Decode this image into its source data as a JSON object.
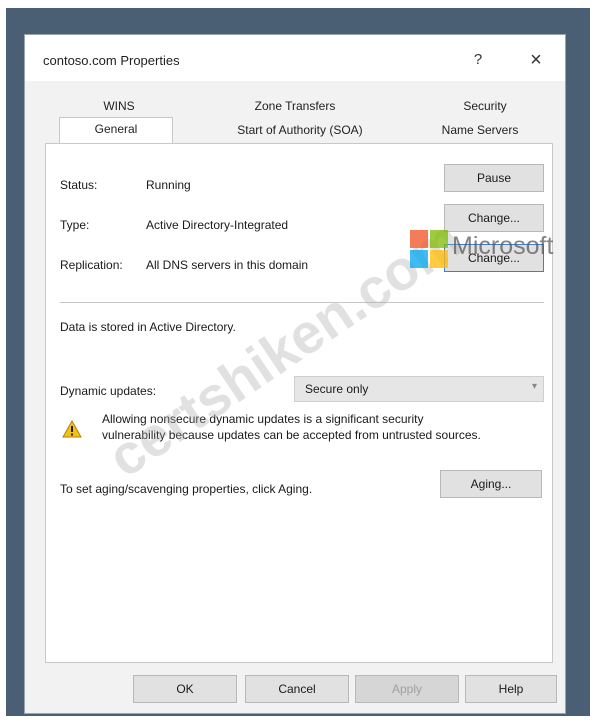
{
  "dialog": {
    "title": "contoso.com Properties",
    "help_glyph": "?",
    "close_glyph": "×"
  },
  "tabs": {
    "row1": [
      "WINS",
      "Zone Transfers",
      "Security"
    ],
    "row2": [
      "General",
      "Start of Authority (SOA)",
      "Name Servers"
    ],
    "active": "General"
  },
  "general": {
    "status_label": "Status:",
    "status_value": "Running",
    "pause_button": "Pause",
    "type_label": "Type:",
    "type_value": "Active Directory-Integrated",
    "type_change_button": "Change...",
    "replication_label": "Replication:",
    "replication_value": "All DNS servers in this domain",
    "replication_change_button": "Change...",
    "storage_note": "Data is stored in Active Directory.",
    "dynamic_updates_label": "Dynamic updates:",
    "dynamic_updates_value": "Secure only",
    "warning_line1": "Allowing nonsecure dynamic updates is a significant security",
    "warning_line2": "vulnerability because updates can be accepted from untrusted sources.",
    "aging_text": "To set aging/scavenging properties, click Aging.",
    "aging_button": "Aging..."
  },
  "footer": {
    "ok": "OK",
    "cancel": "Cancel",
    "apply": "Apply",
    "help": "Help"
  },
  "overlay": {
    "watermark": "certshiken.com",
    "brand": "Microsoft"
  }
}
